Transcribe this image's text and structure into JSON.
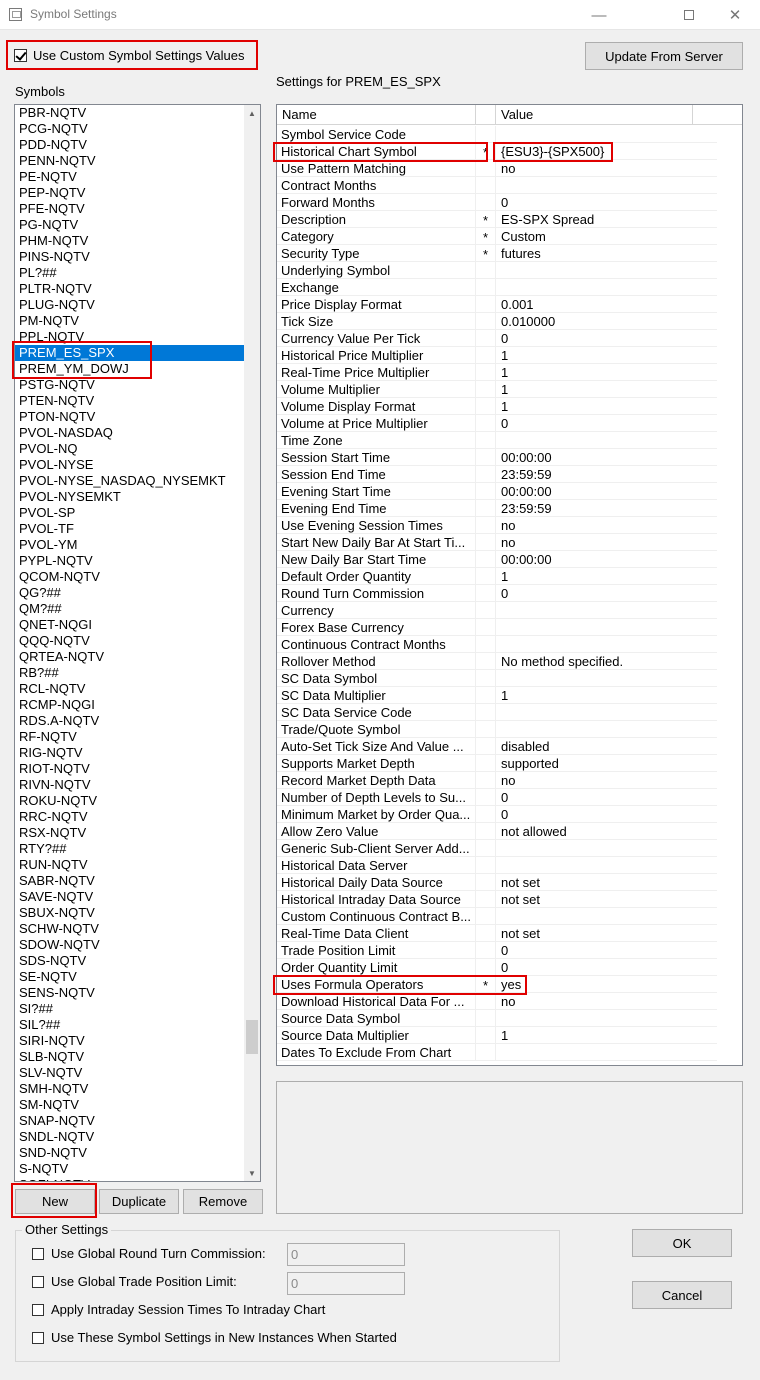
{
  "window": {
    "title": "Symbol Settings",
    "minimize_glyph": "—",
    "close_glyph": "✕"
  },
  "top": {
    "custom_values_label": "Use Custom Symbol Settings Values",
    "custom_values_checked": true,
    "update_button": "Update From Server",
    "symbols_label": "Symbols",
    "settings_for_label": "Settings for PREM_ES_SPX"
  },
  "symbols": [
    "PBR-NQTV",
    "PCG-NQTV",
    "PDD-NQTV",
    "PENN-NQTV",
    "PE-NQTV",
    "PEP-NQTV",
    "PFE-NQTV",
    "PG-NQTV",
    "PHM-NQTV",
    "PINS-NQTV",
    "PL?##",
    "PLTR-NQTV",
    "PLUG-NQTV",
    "PM-NQTV",
    "PPL-NQTV",
    "PREM_ES_SPX",
    "PREM_YM_DOWJ",
    "PSTG-NQTV",
    "PTEN-NQTV",
    "PTON-NQTV",
    "PVOL-NASDAQ",
    "PVOL-NQ",
    "PVOL-NYSE",
    "PVOL-NYSE_NASDAQ_NYSEMKT",
    "PVOL-NYSEMKT",
    "PVOL-SP",
    "PVOL-TF",
    "PVOL-YM",
    "PYPL-NQTV",
    "QCOM-NQTV",
    "QG?##",
    "QM?##",
    "QNET-NQGI",
    "QQQ-NQTV",
    "QRTEA-NQTV",
    "RB?##",
    "RCL-NQTV",
    "RCMP-NQGI",
    "RDS.A-NQTV",
    "RF-NQTV",
    "RIG-NQTV",
    "RIOT-NQTV",
    "RIVN-NQTV",
    "ROKU-NQTV",
    "RRC-NQTV",
    "RSX-NQTV",
    "RTY?##",
    "RUN-NQTV",
    "SABR-NQTV",
    "SAVE-NQTV",
    "SBUX-NQTV",
    "SCHW-NQTV",
    "SDOW-NQTV",
    "SDS-NQTV",
    "SE-NQTV",
    "SENS-NQTV",
    "SI?##",
    "SIL?##",
    "SIRI-NQTV",
    "SLB-NQTV",
    "SLV-NQTV",
    "SMH-NQTV",
    "SM-NQTV",
    "SNAP-NQTV",
    "SNDL-NQTV",
    "SND-NQTV",
    "S-NQTV",
    "SOFI-NQTV"
  ],
  "selected_symbol_index": 15,
  "list_scroll": {
    "up": "▲",
    "down": "▼"
  },
  "list_buttons": {
    "new": "New",
    "duplicate": "Duplicate",
    "remove": "Remove"
  },
  "grid": {
    "col_name": "Name",
    "col_value": "Value",
    "rows": [
      {
        "name": "Symbol Service Code",
        "flag": "",
        "value": ""
      },
      {
        "name": "Historical Chart Symbol",
        "flag": "*",
        "value": "{ESU3}-{SPX500}"
      },
      {
        "name": "Use Pattern Matching",
        "flag": "",
        "value": "no"
      },
      {
        "name": "Contract Months",
        "flag": "",
        "value": ""
      },
      {
        "name": "Forward Months",
        "flag": "",
        "value": "0"
      },
      {
        "name": "Description",
        "flag": "*",
        "value": "ES-SPX Spread"
      },
      {
        "name": "Category",
        "flag": "*",
        "value": "Custom"
      },
      {
        "name": "Security Type",
        "flag": "*",
        "value": "futures"
      },
      {
        "name": "Underlying Symbol",
        "flag": "",
        "value": ""
      },
      {
        "name": "Exchange",
        "flag": "",
        "value": ""
      },
      {
        "name": "Price Display Format",
        "flag": "",
        "value": "0.001"
      },
      {
        "name": "Tick Size",
        "flag": "",
        "value": "0.010000"
      },
      {
        "name": "Currency Value Per Tick",
        "flag": "",
        "value": "0"
      },
      {
        "name": "Historical Price Multiplier",
        "flag": "",
        "value": "1"
      },
      {
        "name": "Real-Time Price Multiplier",
        "flag": "",
        "value": "1"
      },
      {
        "name": "Volume Multiplier",
        "flag": "",
        "value": "1"
      },
      {
        "name": "Volume Display Format",
        "flag": "",
        "value": "1"
      },
      {
        "name": "Volume at Price Multiplier",
        "flag": "",
        "value": "0"
      },
      {
        "name": "Time Zone",
        "flag": "",
        "value": ""
      },
      {
        "name": "Session Start Time",
        "flag": "",
        "value": "00:00:00"
      },
      {
        "name": "Session End Time",
        "flag": "",
        "value": "23:59:59"
      },
      {
        "name": "Evening Start Time",
        "flag": "",
        "value": "00:00:00"
      },
      {
        "name": "Evening End Time",
        "flag": "",
        "value": "23:59:59"
      },
      {
        "name": "Use Evening Session Times",
        "flag": "",
        "value": "no"
      },
      {
        "name": "Start New Daily Bar At Start Ti...",
        "flag": "",
        "value": "no"
      },
      {
        "name": "New Daily Bar Start Time",
        "flag": "",
        "value": "00:00:00"
      },
      {
        "name": "Default Order Quantity",
        "flag": "",
        "value": "1"
      },
      {
        "name": "Round Turn Commission",
        "flag": "",
        "value": "0"
      },
      {
        "name": "Currency",
        "flag": "",
        "value": ""
      },
      {
        "name": "Forex Base Currency",
        "flag": "",
        "value": ""
      },
      {
        "name": "Continuous Contract Months",
        "flag": "",
        "value": ""
      },
      {
        "name": "Rollover Method",
        "flag": "",
        "value": "No method specified."
      },
      {
        "name": "SC Data Symbol",
        "flag": "",
        "value": ""
      },
      {
        "name": "SC Data Multiplier",
        "flag": "",
        "value": "1"
      },
      {
        "name": "SC Data Service Code",
        "flag": "",
        "value": ""
      },
      {
        "name": "Trade/Quote Symbol",
        "flag": "",
        "value": ""
      },
      {
        "name": "Auto-Set Tick Size And Value ...",
        "flag": "",
        "value": "disabled"
      },
      {
        "name": "Supports Market Depth",
        "flag": "",
        "value": "supported"
      },
      {
        "name": "Record Market Depth Data",
        "flag": "",
        "value": "no"
      },
      {
        "name": "Number of Depth Levels to Su...",
        "flag": "",
        "value": "0"
      },
      {
        "name": "Minimum Market by Order Qua...",
        "flag": "",
        "value": "0"
      },
      {
        "name": "Allow Zero Value",
        "flag": "",
        "value": "not allowed"
      },
      {
        "name": "Generic Sub-Client Server Add...",
        "flag": "",
        "value": ""
      },
      {
        "name": "Historical Data Server",
        "flag": "",
        "value": ""
      },
      {
        "name": "Historical Daily Data Source",
        "flag": "",
        "value": "not set"
      },
      {
        "name": "Historical Intraday Data Source",
        "flag": "",
        "value": "not set"
      },
      {
        "name": "Custom Continuous Contract B...",
        "flag": "",
        "value": ""
      },
      {
        "name": "Real-Time Data Client",
        "flag": "",
        "value": "not set"
      },
      {
        "name": "Trade Position Limit",
        "flag": "",
        "value": "0"
      },
      {
        "name": "Order Quantity Limit",
        "flag": "",
        "value": "0"
      },
      {
        "name": "Uses Formula Operators",
        "flag": "*",
        "value": "yes"
      },
      {
        "name": "Download Historical Data For ...",
        "flag": "",
        "value": "no"
      },
      {
        "name": "Source Data Symbol",
        "flag": "",
        "value": ""
      },
      {
        "name": "Source Data Multiplier",
        "flag": "",
        "value": "1"
      },
      {
        "name": "Dates To Exclude From Chart",
        "flag": "",
        "value": ""
      }
    ]
  },
  "other_settings": {
    "legend": "Other Settings",
    "global_rtc_label": "Use Global Round Turn Commission:",
    "global_rtc_value": "0",
    "global_tpl_label": "Use Global Trade Position Limit:",
    "global_tpl_value": "0",
    "apply_intraday_label": "Apply Intraday Session Times To Intraday Chart",
    "use_in_new_label": "Use These Symbol Settings in New Instances When Started"
  },
  "dialog_buttons": {
    "ok": "OK",
    "cancel": "Cancel"
  },
  "annotation_color": "#e00000",
  "selection_color": "#0078d7"
}
